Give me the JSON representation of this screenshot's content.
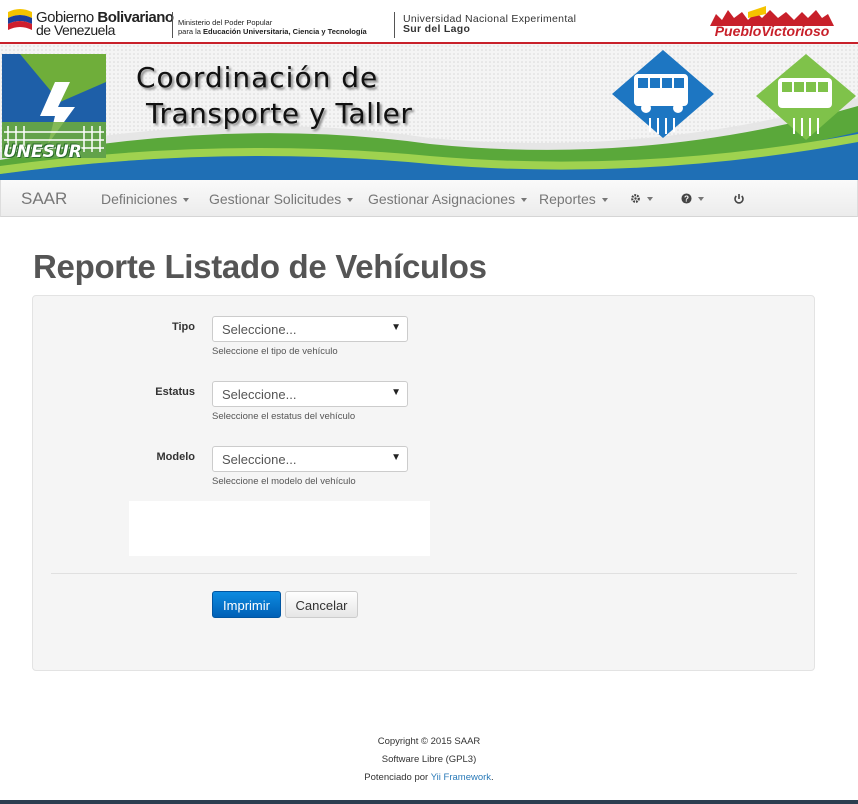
{
  "govbar": {
    "gob_line1": "Gobierno",
    "gob_line1_bold": "Bolivariano",
    "gob_line2": "de Venezuela",
    "ministry_line1": "Ministerio del Poder Popular",
    "ministry_line2_prefix": "para la",
    "ministry_line2_bold": "Educación Universitaria, Ciencia y Tecnología",
    "univ_line1": "Universidad Nacional Experimental",
    "univ_line2": "Sur del Lago",
    "pueblo_logo_text": "PuebloVictorioso"
  },
  "banner": {
    "title_line1": "Coordinación de",
    "title_line2": "Transporte y Taller",
    "logo_text": "UNESUR"
  },
  "navbar": {
    "brand": "SAAR",
    "items": [
      {
        "label": "Definiciones"
      },
      {
        "label": "Gestionar Solicitudes"
      },
      {
        "label": "Gestionar Asignaciones"
      },
      {
        "label": "Reportes"
      }
    ],
    "icons": [
      "gear-icon",
      "help-icon",
      "power-icon"
    ]
  },
  "page": {
    "title": "Reporte Listado de Vehículos"
  },
  "form": {
    "tipo": {
      "label": "Tipo",
      "value": "Seleccione...",
      "hint": "Seleccione el tipo de vehículo"
    },
    "estatus": {
      "label": "Estatus",
      "value": "Seleccione...",
      "hint": "Seleccione el estatus del vehículo"
    },
    "modelo": {
      "label": "Modelo",
      "value": "Seleccione...",
      "hint": "Seleccione el modelo del vehículo"
    },
    "print_label": "Imprimir",
    "cancel_label": "Cancelar"
  },
  "footer": {
    "copyright": "Copyright © 2015 SAAR",
    "license": "Software Libre (GPL3)",
    "powered_prefix": "Potenciado por",
    "powered_link": "Yii Framework",
    "powered_suffix": "."
  },
  "colors": {
    "accent_red": "#c8202a",
    "primary_blue": "#0a74cf",
    "banner_green": "#5aa83a",
    "banner_blue": "#1f6fb5"
  }
}
